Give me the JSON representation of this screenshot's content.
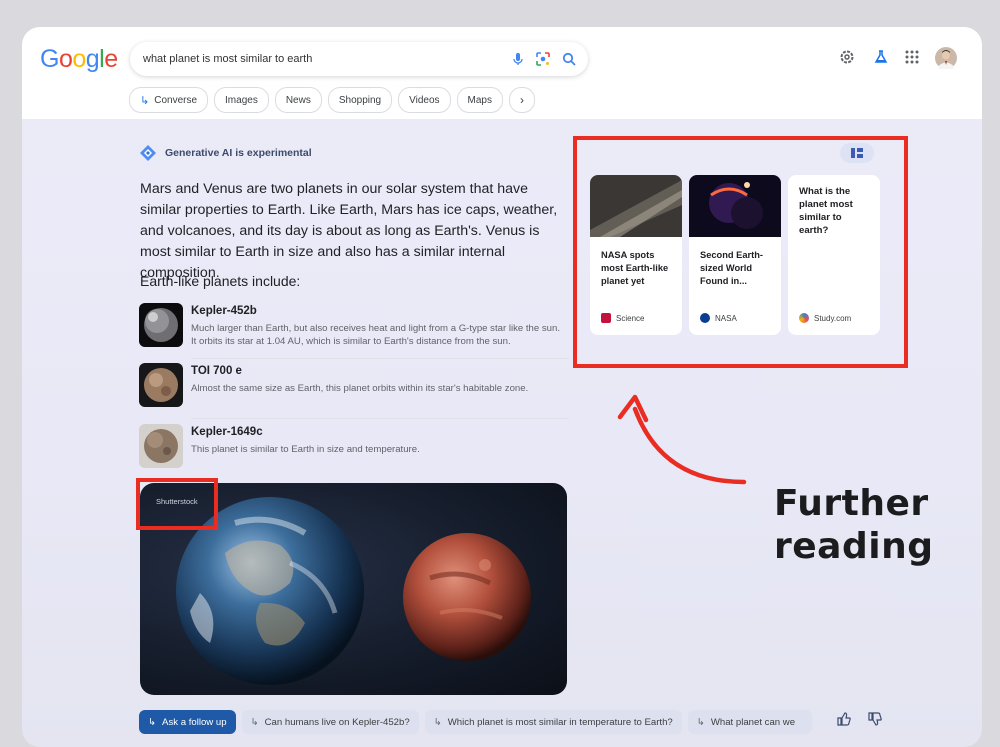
{
  "search": {
    "query": "what planet is most similar to earth",
    "logo": [
      "G",
      "o",
      "o",
      "g",
      "l",
      "e"
    ]
  },
  "header_icons": [
    "mic-icon",
    "lens-icon",
    "search-icon",
    "settings-icon",
    "labs-icon",
    "apps-icon",
    "avatar"
  ],
  "chips": [
    {
      "label": "Converse",
      "icon": "arrow-icon"
    },
    {
      "label": "Images"
    },
    {
      "label": "News"
    },
    {
      "label": "Shopping"
    },
    {
      "label": "Videos"
    },
    {
      "label": "Maps"
    }
  ],
  "ai": {
    "badge": "Generative AI is experimental",
    "summary": "Mars and Venus are two planets in our solar system that have similar properties to Earth. Like Earth, Mars has ice caps, weather, and volcanoes, and its day is about as long as Earth's. Venus is most similar to Earth in size and also has a similar internal composition.",
    "subhead": "Earth-like planets include:",
    "planets": [
      {
        "name": "Kepler-452b",
        "desc": "Much larger than Earth, but also receives heat and light from a G-type star like the sun. It orbits its star at 1.04 AU, which is similar to Earth's distance from the sun."
      },
      {
        "name": "TOI 700 e",
        "desc": "Almost the same size as Earth, this planet orbits within its star's habitable zone."
      },
      {
        "name": "Kepler-1649c",
        "desc": "This planet is similar to Earth in size and temperature."
      }
    ],
    "image_credit": "Shutterstock"
  },
  "cards": [
    {
      "title": "NASA spots most Earth-like planet yet",
      "source": "Science",
      "source_color": "#c4123f"
    },
    {
      "title": "Second Earth-sized World Found in...",
      "source": "NASA",
      "source_color": "#0b3d91"
    },
    {
      "title": "What is the planet most similar to earth?",
      "source": "Study.com",
      "source_color": "#3b82c4"
    }
  ],
  "annotation": {
    "line1": "Further",
    "line2": "reading",
    "color": "#ea2d22"
  },
  "followups": [
    {
      "label": "Ask a follow up",
      "primary": true
    },
    {
      "label": "Can humans live on Kepler-452b?"
    },
    {
      "label": "Which planet is most similar in temperature to Earth?"
    },
    {
      "label": "What planet can we"
    }
  ]
}
